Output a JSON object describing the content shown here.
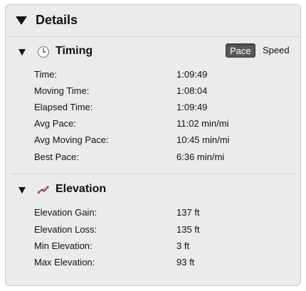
{
  "panel": {
    "title": "Details"
  },
  "timing": {
    "title": "Timing",
    "icon": "clock-icon",
    "toggle": {
      "pace_label": "Pace",
      "speed_label": "Speed",
      "selected": "Pace"
    },
    "rows": [
      {
        "label": "Time:",
        "value": "1:09:49"
      },
      {
        "label": "Moving Time:",
        "value": "1:08:04"
      },
      {
        "label": "Elapsed Time:",
        "value": "1:09:49"
      },
      {
        "label": "Avg Pace:",
        "value": "11:02 min/mi"
      },
      {
        "label": "Avg Moving Pace:",
        "value": "10:45 min/mi"
      },
      {
        "label": "Best Pace:",
        "value": "6:36 min/mi"
      }
    ]
  },
  "elevation": {
    "title": "Elevation",
    "icon": "elevation-chart-icon",
    "rows": [
      {
        "label": "Elevation Gain:",
        "value": "137 ft"
      },
      {
        "label": "Elevation Loss:",
        "value": "135 ft"
      },
      {
        "label": "Min Elevation:",
        "value": "3 ft"
      },
      {
        "label": "Max Elevation:",
        "value": "93 ft"
      }
    ]
  },
  "colors": {
    "panel_bg": "#ebebeb",
    "toggle_active_bg": "#5a5a5a",
    "icon_line_blue": "#2a5fc4",
    "icon_point_red": "#d9302b"
  }
}
